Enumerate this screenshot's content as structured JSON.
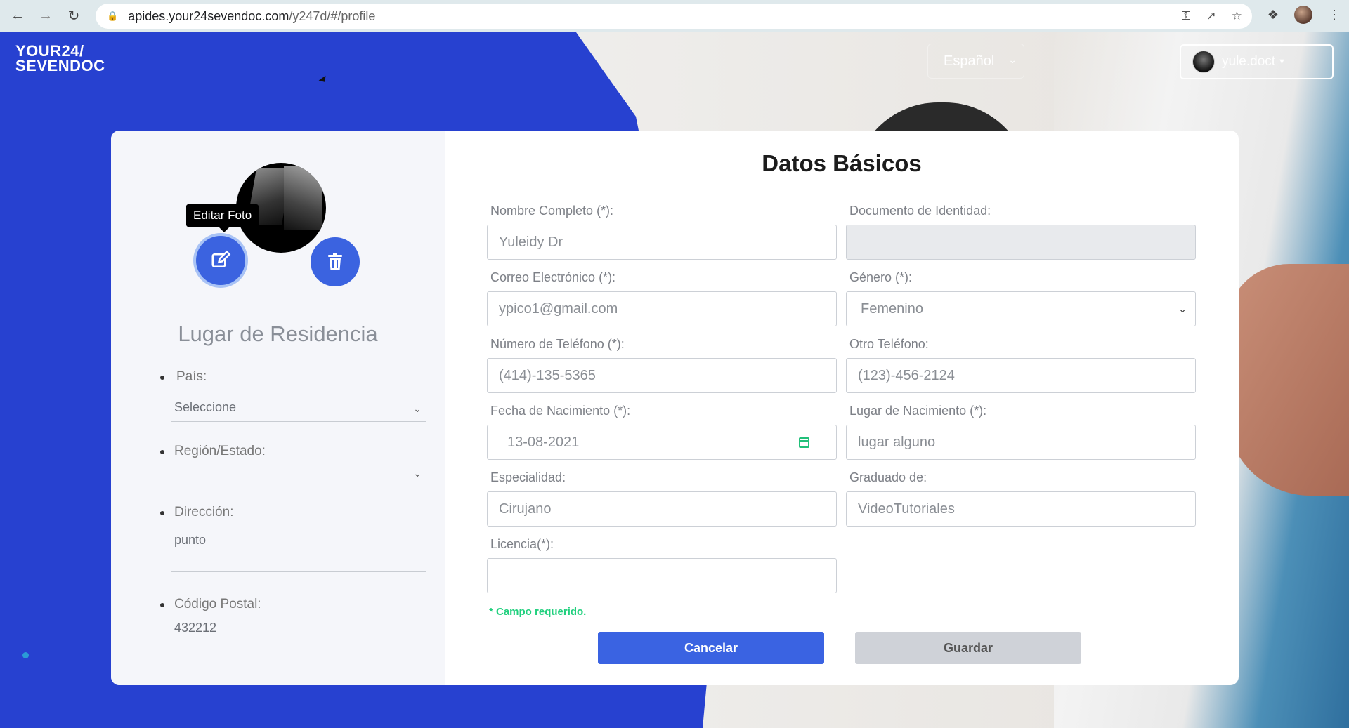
{
  "browser": {
    "url_host": "apides.your24sevendoc.com",
    "url_path": "/y247d/#/profile"
  },
  "header": {
    "logo_line1": "YOUR24/",
    "logo_line2": "SEVENDOC",
    "language": "Español",
    "user_name": "yule.doct"
  },
  "profile": {
    "tooltip": "Editar Foto",
    "residence_title": "Lugar de Residencia",
    "residence": {
      "country_label": "País:",
      "country_value": "Seleccione",
      "region_label": "Región/Estado:",
      "region_value": "",
      "address_label": "Dirección:",
      "address_value": "punto",
      "postal_label": "Código Postal:",
      "postal_value": "432212"
    }
  },
  "form": {
    "title": "Datos Básicos",
    "full_name_label": "Nombre Completo (*):",
    "full_name_value": "Yuleidy Dr",
    "id_doc_label": "Documento de Identidad:",
    "id_doc_value": "",
    "email_label": "Correo Electrónico (*):",
    "email_value": "ypico1@gmail.com",
    "gender_label": "Género (*):",
    "gender_value": "Femenino",
    "phone_label": "Número de Teléfono (*):",
    "phone_value": "(414)-135-5365",
    "other_phone_label": "Otro Teléfono:",
    "other_phone_value": "(123)-456-2124",
    "birth_date_label": "Fecha de Nacimiento (*):",
    "birth_date_value": "13-08-2021",
    "birth_place_label": "Lugar de Nacimiento (*):",
    "birth_place_value": "lugar alguno",
    "specialty_label": "Especialidad:",
    "specialty_value": "Cirujano",
    "graduated_label": "Graduado de:",
    "graduated_value": "VideoTutoriales",
    "license_label": "Licencia(*):",
    "license_value": "",
    "required_note": "* Campo requerido.",
    "cancel_label": "Cancelar",
    "save_label": "Guardar"
  },
  "colors": {
    "brand_blue": "#2741d0",
    "button_blue": "#3a63e2",
    "required_green": "#21d07e"
  }
}
